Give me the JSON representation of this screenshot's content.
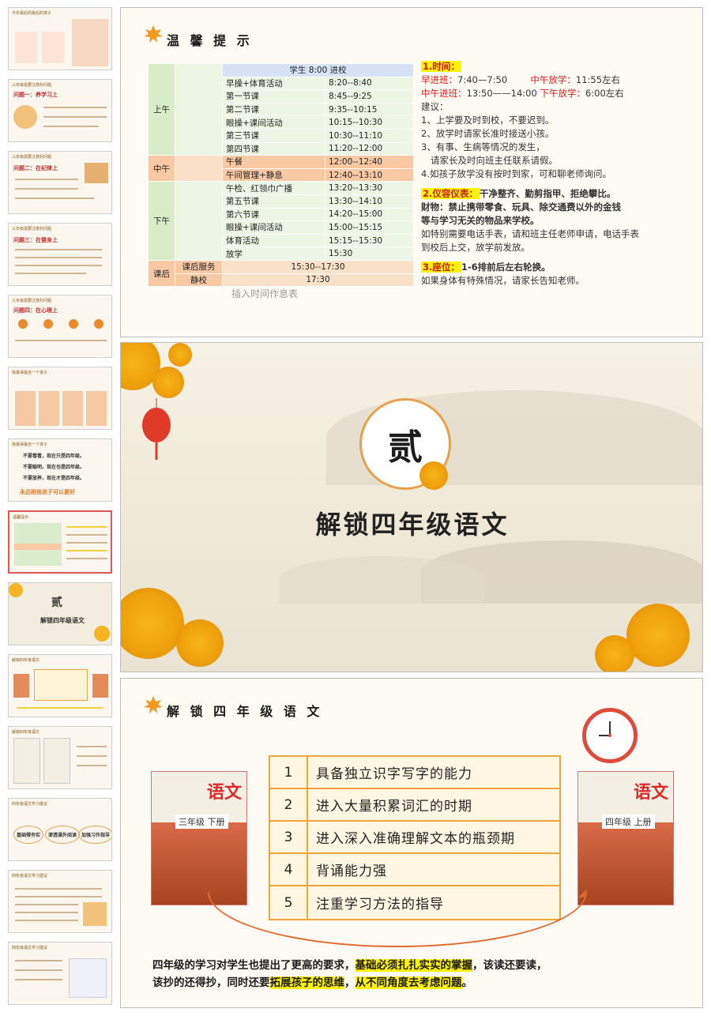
{
  "sidebar": {
    "thumbnails": [
      {
        "title": "今年最后的最后的孩子"
      },
      {
        "title": "三年级需要注意的问题",
        "heading": "问题一：养学习上"
      },
      {
        "title": "三年级需要注意的问题",
        "heading": "问题二：在纪律上"
      },
      {
        "title": "三年级需要注意的问题",
        "heading": "问题三：在健身上"
      },
      {
        "title": "三年级需要注意的问题",
        "heading": "问题四：在心理上"
      },
      {
        "title": "我最得最自一个孩子"
      },
      {
        "title": "我最得最自一个孩子",
        "lines": [
          "不要看看，现在只是四年级。",
          "不要聪明，现在也是四年级。",
          "不要放养，现在才是四年级。"
        ],
        "footer": "永远相信孩子可以更好"
      },
      {
        "title": "温馨提示"
      },
      {
        "title": "贰",
        "heading": "解锁四年级语文"
      },
      {
        "title": "解锁四年级语文"
      },
      {
        "title": "解锁四年级语文"
      },
      {
        "title": "四年级语文学习建议",
        "items": [
          "基础得夯实",
          "渗透课外阅读",
          "加强习作指导"
        ]
      },
      {
        "title": "四年级语文学习建议"
      },
      {
        "title": "四年级语文学习建议"
      }
    ]
  },
  "slide1": {
    "title": "温 馨 提 示",
    "table": {
      "header": "学生 8:00 进校",
      "rows": [
        {
          "period": "上午",
          "activity": "早操+体育活动",
          "time": "8:20--8:40"
        },
        {
          "period": "",
          "activity": "第一节课",
          "time": "8:45--9:25"
        },
        {
          "period": "",
          "activity": "第二节课",
          "time": "9:35--10:15"
        },
        {
          "period": "",
          "activity": "眼操+课间活动",
          "time": "10:15--10:30"
        },
        {
          "period": "",
          "activity": "第三节课",
          "time": "10:30--11:10"
        },
        {
          "period": "",
          "activity": "第四节课",
          "time": "11:20--12:00"
        },
        {
          "period": "中午",
          "activity": "午餐",
          "time": "12:00--12:40"
        },
        {
          "period": "",
          "activity": "午间管理+静息",
          "time": "12:40--13:10"
        },
        {
          "period": "下午",
          "activity": "午检、红领巾广播",
          "time": "13:20--13:30"
        },
        {
          "period": "",
          "activity": "第五节课",
          "time": "13:30--14:10"
        },
        {
          "period": "",
          "activity": "第六节课",
          "time": "14:20--15:00"
        },
        {
          "period": "",
          "activity": "眼操+课间活动",
          "time": "15:00--15:15"
        },
        {
          "period": "",
          "activity": "体育活动",
          "time": "15:15--15:30"
        },
        {
          "period": "",
          "activity": "放学",
          "time": "15:30"
        }
      ],
      "after": {
        "period": "课后",
        "rows": [
          {
            "activity": "课后服务",
            "time": "15:30--17:30"
          },
          {
            "activity": "静校",
            "time": "17:30"
          }
        ]
      }
    },
    "caption": "插入时间作息表",
    "notes": {
      "time_heading": "1.时间：",
      "l1a": "早进班：",
      "l1b": "7:40—7:50",
      "l1c": "中午放学：",
      "l1d": "11:55左右",
      "l2a": "中午进班：",
      "l2b": "13:50——14:00",
      "l2c": "下午放学：",
      "l2d": "6:00左右",
      "l3": "建议：",
      "l4": "1、上学要及时到校，不要迟到。",
      "l5": "2、放学时请家长准时接送小孩。",
      "l6": "3、有事、生病等情况的发生，",
      "l7": "   请家长及时向班主任联系请假。",
      "l8": "4.如孩子放学没有按时到家，可和聊老师询问。",
      "dress_heading": "2.仪容仪表：",
      "d1": "干净整齐、勤剪指甲、拒绝攀比。",
      "d2": "财物：禁止携带零食、玩具、除交通费以外的金钱",
      "d3": "等与学习无关的物品来学校。",
      "d4": "如特别需要电话手表，请和班主任老师申请，电话手表",
      "d5": "到校后上交，放学前发放。",
      "seat_heading": "3.座位：",
      "s1": "1-6排前后左右轮换。",
      "s2": "如果身体有特殊情况，请家长告知老师。"
    }
  },
  "slide2": {
    "numeral": "贰",
    "title": "解锁四年级语文"
  },
  "slide3": {
    "title": "解 锁 四 年 级 语 文",
    "items": [
      {
        "num": "1",
        "text": "具备独立识字写字的能力"
      },
      {
        "num": "2",
        "text": "进入大量积累词汇的时期"
      },
      {
        "num": "3",
        "text": "进入深入准确理解文本的瓶颈期"
      },
      {
        "num": "4",
        "text": "背诵能力强"
      },
      {
        "num": "5",
        "text": "注重学习方法的指导"
      }
    ],
    "book_left": {
      "brand": "语文",
      "grade": "三年级 下册"
    },
    "book_right": {
      "brand": "语文",
      "grade": "四年级 上册"
    },
    "bottom": {
      "p1": "四年级的学习对学生也提出了更高的要求，",
      "p2": "基础必须扎扎实实的掌握",
      "p3": "，该读还要读，",
      "p4": "该抄的还得抄，同时还要",
      "p5": "拓展孩子的思维",
      "p6": "，",
      "p7": "从不同角度去考虑问题",
      "p8": "。"
    }
  }
}
